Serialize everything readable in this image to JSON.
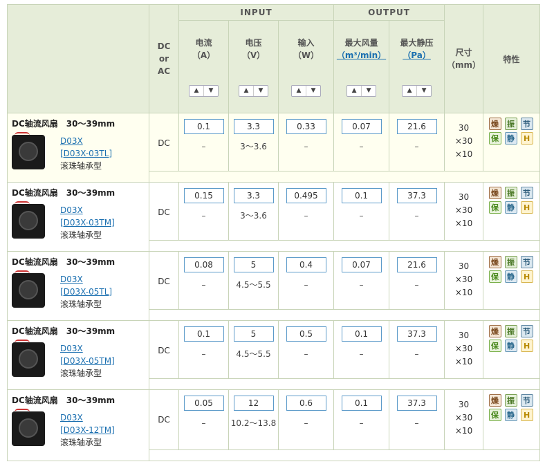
{
  "header": {
    "input_label": "INPUT",
    "output_label": "OUTPUT",
    "dc_ac": [
      "DC",
      "or",
      "AC"
    ],
    "columns": [
      {
        "name": "电流",
        "unit": "（A）"
      },
      {
        "name": "电压",
        "unit": "（V）"
      },
      {
        "name": "输入",
        "unit": "（W）"
      },
      {
        "name": "最大风量",
        "unit": "（m³/min）"
      },
      {
        "name": "最大静压",
        "unit": "（Pa）"
      }
    ],
    "size_label": "尺寸",
    "size_unit": "（mm）",
    "feature_label": "特性",
    "sort_up": "▲",
    "sort_down": "▼"
  },
  "rows": [
    {
      "title": "DC轴流风扇　30～39mm",
      "model": "D03X",
      "model_code": "[D03X-03TL]",
      "bearing": "滚珠轴承型",
      "dc": "DC",
      "current": "0.1",
      "current_range": "–",
      "voltage": "3.3",
      "voltage_range": "3～3.6",
      "input": "0.33",
      "input_range": "–",
      "airflow": "0.07",
      "airflow_range": "–",
      "pressure": "21.6",
      "pressure_range": "–",
      "size": [
        "30",
        "×30",
        "×10"
      ]
    },
    {
      "title": "DC轴流风扇　30～39mm",
      "model": "D03X",
      "model_code": "[D03X-03TM]",
      "bearing": "滚珠轴承型",
      "dc": "DC",
      "current": "0.15",
      "current_range": "–",
      "voltage": "3.3",
      "voltage_range": "3～3.6",
      "input": "0.495",
      "input_range": "–",
      "airflow": "0.1",
      "airflow_range": "–",
      "pressure": "37.3",
      "pressure_range": "–",
      "size": [
        "30",
        "×30",
        "×10"
      ]
    },
    {
      "title": "DC轴流风扇　30～39mm",
      "model": "D03X",
      "model_code": "[D03X-05TL]",
      "bearing": "滚珠轴承型",
      "dc": "DC",
      "current": "0.08",
      "current_range": "–",
      "voltage": "5",
      "voltage_range": "4.5～5.5",
      "input": "0.4",
      "input_range": "–",
      "airflow": "0.07",
      "airflow_range": "–",
      "pressure": "21.6",
      "pressure_range": "–",
      "size": [
        "30",
        "×30",
        "×10"
      ]
    },
    {
      "title": "DC轴流风扇　30～39mm",
      "model": "D03X",
      "model_code": "[D03X-05TM]",
      "bearing": "滚珠轴承型",
      "dc": "DC",
      "current": "0.1",
      "current_range": "–",
      "voltage": "5",
      "voltage_range": "4.5～5.5",
      "input": "0.5",
      "input_range": "–",
      "airflow": "0.1",
      "airflow_range": "–",
      "pressure": "37.3",
      "pressure_range": "–",
      "size": [
        "30",
        "×30",
        "×10"
      ]
    },
    {
      "title": "DC轴流风扇　30～39mm",
      "model": "D03X",
      "model_code": "[D03X-12TM]",
      "bearing": "滚珠轴承型",
      "dc": "DC",
      "current": "0.05",
      "current_range": "–",
      "voltage": "12",
      "voltage_range": "10.2～13.8",
      "input": "0.6",
      "input_range": "–",
      "airflow": "0.1",
      "airflow_range": "–",
      "pressure": "37.3",
      "pressure_range": "–",
      "size": [
        "30",
        "×30",
        "×10"
      ]
    }
  ],
  "badges": [
    {
      "char": "燥",
      "cls": "b-noise",
      "name": "low-noise-badge"
    },
    {
      "char": "振",
      "cls": "b-vib",
      "name": "low-vibration-badge"
    },
    {
      "char": "节",
      "cls": "b-save",
      "name": "energy-saving-badge"
    },
    {
      "char": "保",
      "cls": "b-prot",
      "name": "protection-badge"
    },
    {
      "char": "静",
      "cls": "b-quiet",
      "name": "quiet-badge"
    },
    {
      "char": "H",
      "cls": "b-h",
      "name": "h-badge"
    }
  ]
}
